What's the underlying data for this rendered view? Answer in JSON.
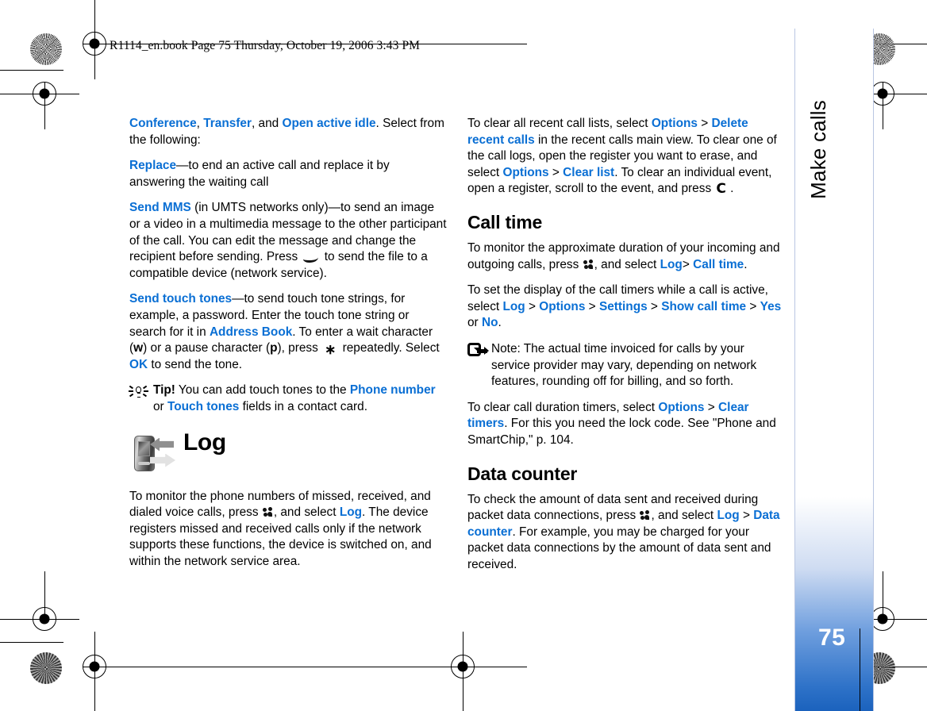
{
  "print_header": "R1114_en.book  Page 75  Thursday, October 19, 2006  3:43 PM",
  "side_tab": {
    "chapter_title": "Make calls",
    "page_number": "75",
    "accent_color": "#1b62bd"
  },
  "theme": {
    "keyword_color": "#0a6fd4",
    "text_color": "#000000",
    "page_background": "#ffffff"
  },
  "left_column": {
    "paragraphs": [
      {
        "id": "p-conference",
        "runs": [
          {
            "t": "Conference",
            "s": "kw"
          },
          {
            "t": ", ",
            "s": "n"
          },
          {
            "t": "Transfer",
            "s": "kw"
          },
          {
            "t": ", and ",
            "s": "n"
          },
          {
            "t": "Open active idle",
            "s": "kw"
          },
          {
            "t": ". Select from the following:",
            "s": "n"
          }
        ]
      },
      {
        "id": "p-replace",
        "runs": [
          {
            "t": "Replace",
            "s": "kw"
          },
          {
            "t": "—to end an active call and replace it by answering the waiting call",
            "s": "n"
          }
        ]
      },
      {
        "id": "p-send-mms",
        "runs": [
          {
            "t": "Send MMS",
            "s": "kw"
          },
          {
            "t": " (in UMTS networks only)—to send an image or a video in a multimedia message to the other participant of the call. You can edit the message and change the recipient before sending. Press ",
            "s": "n"
          },
          {
            "t": "",
            "s": "glyph-end-call"
          },
          {
            "t": " to send the file to a compatible device (network service).",
            "s": "n"
          }
        ]
      },
      {
        "id": "p-send-touch-tones",
        "runs": [
          {
            "t": "Send touch tones",
            "s": "kw"
          },
          {
            "t": "—to send touch tone strings, for example, a password. Enter the touch tone string or search for it in ",
            "s": "n"
          },
          {
            "t": "Address Book",
            "s": "kw"
          },
          {
            "t": ". To enter a wait character (",
            "s": "n"
          },
          {
            "t": "w",
            "s": "blk"
          },
          {
            "t": ") or a pause character (",
            "s": "n"
          },
          {
            "t": "p",
            "s": "blk"
          },
          {
            "t": "), press ",
            "s": "n"
          },
          {
            "t": "",
            "s": "glyph-star"
          },
          {
            "t": " repeatedly. Select ",
            "s": "n"
          },
          {
            "t": "OK",
            "s": "kw"
          },
          {
            "t": " to send the tone.",
            "s": "n"
          }
        ]
      }
    ],
    "tip": {
      "icon": "lightbulb-icon",
      "runs": [
        {
          "t": "Tip!",
          "s": "blk"
        },
        {
          "t": " You can add touch tones to the ",
          "s": "n"
        },
        {
          "t": "Phone number",
          "s": "kw"
        },
        {
          "t": " or ",
          "s": "n"
        },
        {
          "t": "Touch tones",
          "s": "kw"
        },
        {
          "t": " fields in a contact card.",
          "s": "n"
        }
      ]
    },
    "chapter": {
      "icon": "log-phone-arrows-icon",
      "title": "Log"
    },
    "paragraphs_after": [
      {
        "id": "p-log-intro",
        "runs": [
          {
            "t": "To monitor the phone numbers of missed, received, and dialed voice calls, press ",
            "s": "n"
          },
          {
            "t": "",
            "s": "glyph-menu-key"
          },
          {
            "t": ", and select ",
            "s": "n"
          },
          {
            "t": "Log",
            "s": "kw"
          },
          {
            "t": ". The device registers missed and received calls only if the network supports these functions, the device is switched on, and within the network service area.",
            "s": "n"
          }
        ]
      }
    ]
  },
  "right_column": {
    "paragraphs": [
      {
        "id": "p-clear-recent",
        "runs": [
          {
            "t": "To clear all recent call lists, select ",
            "s": "n"
          },
          {
            "t": "Options",
            "s": "kw"
          },
          {
            "t": " > ",
            "s": "n"
          },
          {
            "t": "Delete recent calls",
            "s": "kw"
          },
          {
            "t": " in the recent calls main view. To clear one of the call logs, open the register you want to erase, and select ",
            "s": "n"
          },
          {
            "t": "Options",
            "s": "kw"
          },
          {
            "t": " > ",
            "s": "n"
          },
          {
            "t": "Clear list",
            "s": "kw"
          },
          {
            "t": ". To clear an individual event, open a register, scroll to the event, and press ",
            "s": "n"
          },
          {
            "t": "",
            "s": "glyph-clear-key"
          },
          {
            "t": " .",
            "s": "n"
          }
        ]
      }
    ],
    "section_call_time": {
      "heading": "Call time",
      "paragraphs": [
        {
          "id": "p-monitor-duration",
          "runs": [
            {
              "t": "To monitor the approximate duration of your incoming and outgoing calls, press ",
              "s": "n"
            },
            {
              "t": "",
              "s": "glyph-menu-key"
            },
            {
              "t": ", and select ",
              "s": "n"
            },
            {
              "t": "Log",
              "s": "kw"
            },
            {
              "t": "> ",
              "s": "n"
            },
            {
              "t": "Call time",
              "s": "kw"
            },
            {
              "t": ".",
              "s": "n"
            }
          ]
        },
        {
          "id": "p-set-display-timers",
          "runs": [
            {
              "t": "To set the display of the call timers while a call is active, select ",
              "s": "n"
            },
            {
              "t": "Log",
              "s": "kw"
            },
            {
              "t": " > ",
              "s": "n"
            },
            {
              "t": "Options",
              "s": "kw"
            },
            {
              "t": " > ",
              "s": "n"
            },
            {
              "t": "Settings",
              "s": "kw"
            },
            {
              "t": " > ",
              "s": "n"
            },
            {
              "t": "Show call time",
              "s": "kw"
            },
            {
              "t": " > ",
              "s": "n"
            },
            {
              "t": "Yes",
              "s": "kw"
            },
            {
              "t": " or ",
              "s": "n"
            },
            {
              "t": "No",
              "s": "kw"
            },
            {
              "t": ".",
              "s": "n"
            }
          ]
        }
      ],
      "note": {
        "icon": "note-arrow-icon",
        "runs": [
          {
            "t": "Note: The actual time invoiced for calls by your service provider may vary, depending on network features, rounding off for billing, and so forth.",
            "s": "n"
          }
        ]
      },
      "paragraphs_after": [
        {
          "id": "p-clear-timers",
          "runs": [
            {
              "t": "To clear call duration timers, select ",
              "s": "n"
            },
            {
              "t": "Options",
              "s": "kw"
            },
            {
              "t": " > ",
              "s": "n"
            },
            {
              "t": "Clear timers",
              "s": "kw"
            },
            {
              "t": ". For this you need the lock code. See \"Phone and SmartChip,\" p. 104.",
              "s": "n"
            }
          ]
        }
      ]
    },
    "section_data_counter": {
      "heading": "Data counter",
      "paragraphs": [
        {
          "id": "p-data-counter",
          "runs": [
            {
              "t": "To check the amount of data sent and received during packet data connections, press ",
              "s": "n"
            },
            {
              "t": "",
              "s": "glyph-menu-key"
            },
            {
              "t": ", and select ",
              "s": "n"
            },
            {
              "t": "Log",
              "s": "kw"
            },
            {
              "t": " > ",
              "s": "n"
            },
            {
              "t": "Data counter",
              "s": "kw"
            },
            {
              "t": ". For example, you may be charged for your packet data connections by the amount of data sent and received.",
              "s": "n"
            }
          ]
        }
      ]
    }
  }
}
